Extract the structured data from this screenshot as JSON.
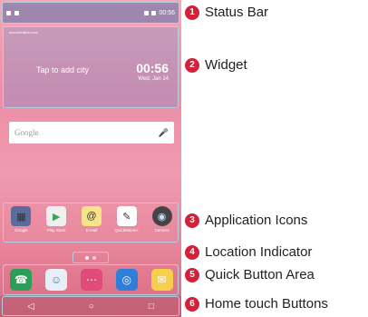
{
  "phone": {
    "status_bar": {
      "time": "00:56"
    },
    "widget": {
      "source": "AccuWeather.com",
      "tap_text": "Tap to add city",
      "time": "00:56",
      "date": "Wed, Jan 14"
    },
    "search": {
      "placeholder": "Google",
      "mic_icon": "mic-icon"
    },
    "apps": [
      {
        "label": "Google",
        "icon": "folder-icon",
        "color": "#5b6b9a"
      },
      {
        "label": "Play Store",
        "icon": "play-store-icon",
        "color": "#f0f0f0"
      },
      {
        "label": "E-mail",
        "icon": "email-icon",
        "color": "#f7e38a"
      },
      {
        "label": "QuickMemo+",
        "icon": "pen-icon",
        "color": "#ffffff"
      },
      {
        "label": "Camera",
        "icon": "camera-icon",
        "color": "#444444"
      }
    ],
    "quick_buttons": [
      {
        "icon": "phone-icon",
        "color": "#2e9d5a"
      },
      {
        "icon": "contacts-icon",
        "color": "#e8eef5"
      },
      {
        "icon": "apps-icon",
        "color": "#e04b7a"
      },
      {
        "icon": "browser-icon",
        "color": "#2f7fd8"
      },
      {
        "icon": "messages-icon",
        "color": "#f6d04a"
      }
    ],
    "home_buttons": [
      "back-icon",
      "home-icon",
      "recent-icon"
    ]
  },
  "callouts": [
    {
      "num": "1",
      "text": "Status Bar"
    },
    {
      "num": "2",
      "text": "Widget"
    },
    {
      "num": "3",
      "text": "Application Icons"
    },
    {
      "num": "4",
      "text": "Location Indicator"
    },
    {
      "num": "5",
      "text": "Quick Button Area"
    },
    {
      "num": "6",
      "text": "Home touch Buttons"
    }
  ]
}
